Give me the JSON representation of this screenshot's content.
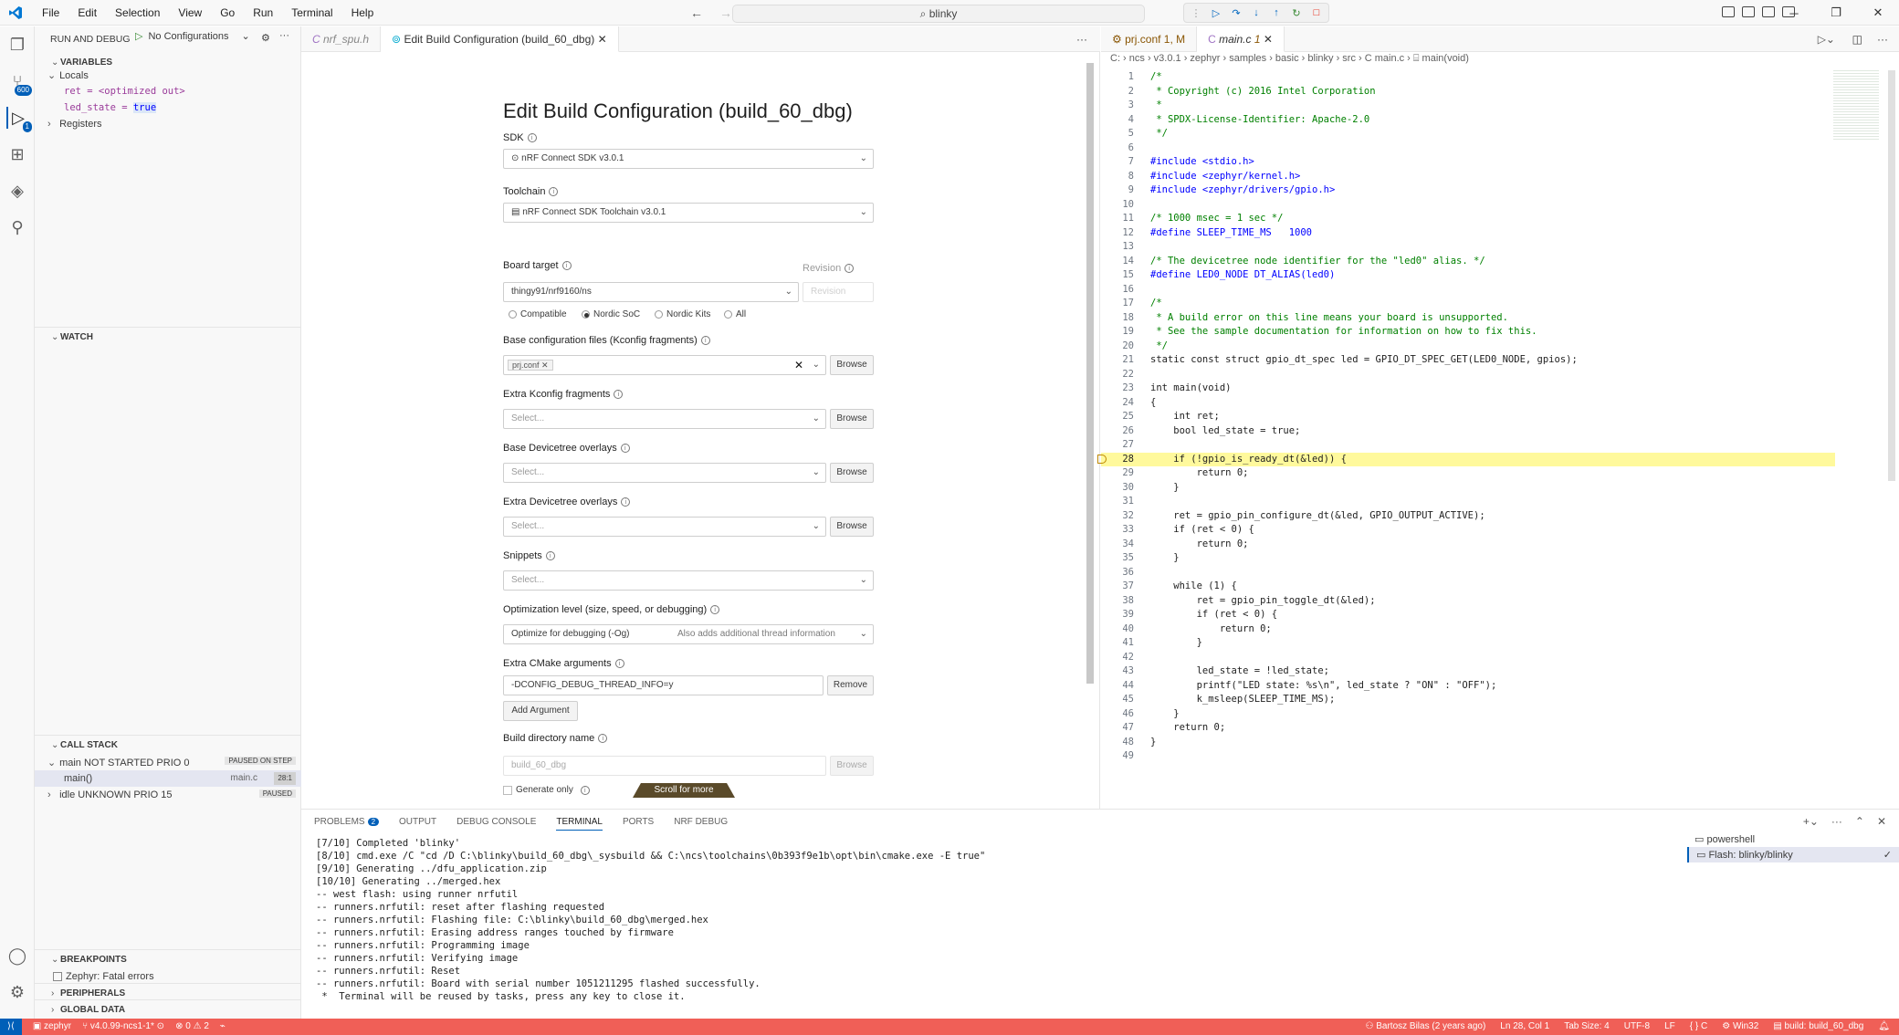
{
  "menu": [
    "File",
    "Edit",
    "Selection",
    "View",
    "Go",
    "Run",
    "Terminal",
    "Help"
  ],
  "search": {
    "text": "blinky"
  },
  "sidebar": {
    "title": "RUN AND DEBUG",
    "config": "No Configurations",
    "variables": {
      "title": "VARIABLES",
      "locals": "Locals",
      "ret": "ret = <optimized out>",
      "led_state_name": "led_state = ",
      "led_state_value": "true",
      "registers": "Registers"
    },
    "watch": "WATCH",
    "callstack": {
      "title": "CALL STACK",
      "thread1": "main NOT STARTED PRIO 0",
      "thread1_state": "PAUSED ON STEP",
      "frame": "main()",
      "frame_file": "main.c",
      "frame_pos": "28:1",
      "thread2": "idle UNKNOWN PRIO 15",
      "thread2_state": "PAUSED"
    },
    "breakpoints": "BREAKPOINTS",
    "bp_item": "Zephyr: Fatal errors",
    "peripherals": "PERIPHERALS",
    "global_data": "GLOBAL DATA"
  },
  "activity_badges": {
    "scm": "600",
    "debug": "1"
  },
  "left_tabs": [
    {
      "label": "nrf_spu.h"
    },
    {
      "label": "Edit Build Configuration (build_60_dbg)"
    }
  ],
  "form": {
    "title": "Edit Build Configuration (build_60_dbg)",
    "sdk_label": "SDK",
    "sdk_value": "nRF Connect SDK v3.0.1",
    "toolchain_label": "Toolchain",
    "toolchain_value": "nRF Connect SDK Toolchain v3.0.1",
    "board_label": "Board target",
    "board_value": "thingy91/nrf9160/ns",
    "revision_label": "Revision",
    "revision_placeholder": "Revision",
    "radios": [
      "Compatible",
      "Nordic SoC",
      "Nordic Kits",
      "All"
    ],
    "kconfig_label": "Base configuration files (Kconfig fragments)",
    "kconfig_chip": "prj.conf",
    "browse": "Browse",
    "extra_kconfig_label": "Extra Kconfig fragments",
    "select_placeholder": "Select...",
    "base_dt_label": "Base Devicetree overlays",
    "extra_dt_label": "Extra Devicetree overlays",
    "snippets_label": "Snippets",
    "opt_label": "Optimization level (size, speed, or debugging)",
    "opt_value": "Optimize for debugging (-Og)",
    "opt_hint": "Also adds additional thread information",
    "cmake_label": "Extra CMake arguments",
    "cmake_value": "-DCONFIG_DEBUG_THREAD_INFO=y",
    "remove": "Remove",
    "add_argument": "Add Argument",
    "builddir_label": "Build directory name",
    "builddir_placeholder": "build_60_dbg",
    "generate_only": "Generate only",
    "scroll_more": "Scroll for more"
  },
  "right_tabs": [
    {
      "label": "prj.conf",
      "suffix": "1, M"
    },
    {
      "label": "main.c",
      "suffix": "1"
    }
  ],
  "breadcrumb": "C: › ncs › v3.0.1 › zephyr › samples › basic › blinky › src › C  main.c › ⌸ main(void)",
  "code": [
    {
      "n": "1",
      "t": "/*",
      "c": "cm"
    },
    {
      "n": "2",
      "t": " * Copyright (c) 2016 Intel Corporation",
      "c": "cm"
    },
    {
      "n": "3",
      "t": " *",
      "c": "cm"
    },
    {
      "n": "4",
      "t": " * SPDX-License-Identifier: Apache-2.0",
      "c": "cm"
    },
    {
      "n": "5",
      "t": " */",
      "c": "cm"
    },
    {
      "n": "6",
      "t": "",
      "c": ""
    },
    {
      "n": "7",
      "t": "#include <stdio.h>",
      "c": "pp"
    },
    {
      "n": "8",
      "t": "#include <zephyr/kernel.h>",
      "c": "pp"
    },
    {
      "n": "9",
      "t": "#include <zephyr/drivers/gpio.h>",
      "c": "pp"
    },
    {
      "n": "10",
      "t": "",
      "c": ""
    },
    {
      "n": "11",
      "t": "/* 1000 msec = 1 sec */",
      "c": "cm"
    },
    {
      "n": "12",
      "t": "#define SLEEP_TIME_MS   1000",
      "c": "pp"
    },
    {
      "n": "13",
      "t": "",
      "c": ""
    },
    {
      "n": "14",
      "t": "/* The devicetree node identifier for the \"led0\" alias. */",
      "c": "cm"
    },
    {
      "n": "15",
      "t": "#define LED0_NODE DT_ALIAS(led0)",
      "c": "pp"
    },
    {
      "n": "16",
      "t": "",
      "c": ""
    },
    {
      "n": "17",
      "t": "/*",
      "c": "cm"
    },
    {
      "n": "18",
      "t": " * A build error on this line means your board is unsupported.",
      "c": "cm"
    },
    {
      "n": "19",
      "t": " * See the sample documentation for information on how to fix this.",
      "c": "cm"
    },
    {
      "n": "20",
      "t": " */",
      "c": "cm"
    },
    {
      "n": "21",
      "t": "static const struct gpio_dt_spec led = GPIO_DT_SPEC_GET(LED0_NODE, gpios);",
      "c": ""
    },
    {
      "n": "22",
      "t": "",
      "c": ""
    },
    {
      "n": "23",
      "t": "int main(void)",
      "c": ""
    },
    {
      "n": "24",
      "t": "{",
      "c": ""
    },
    {
      "n": "25",
      "t": "    int ret;",
      "c": ""
    },
    {
      "n": "26",
      "t": "    bool led_state = true;",
      "c": ""
    },
    {
      "n": "27",
      "t": "",
      "c": ""
    },
    {
      "n": "28",
      "t": "    if (!gpio_is_ready_dt(&led)) {",
      "c": ""
    },
    {
      "n": "29",
      "t": "        return 0;",
      "c": ""
    },
    {
      "n": "30",
      "t": "    }",
      "c": ""
    },
    {
      "n": "31",
      "t": "",
      "c": ""
    },
    {
      "n": "32",
      "t": "    ret = gpio_pin_configure_dt(&led, GPIO_OUTPUT_ACTIVE);",
      "c": ""
    },
    {
      "n": "33",
      "t": "    if (ret < 0) {",
      "c": ""
    },
    {
      "n": "34",
      "t": "        return 0;",
      "c": ""
    },
    {
      "n": "35",
      "t": "    }",
      "c": ""
    },
    {
      "n": "36",
      "t": "",
      "c": ""
    },
    {
      "n": "37",
      "t": "    while (1) {",
      "c": ""
    },
    {
      "n": "38",
      "t": "        ret = gpio_pin_toggle_dt(&led);",
      "c": ""
    },
    {
      "n": "39",
      "t": "        if (ret < 0) {",
      "c": ""
    },
    {
      "n": "40",
      "t": "            return 0;",
      "c": ""
    },
    {
      "n": "41",
      "t": "        }",
      "c": ""
    },
    {
      "n": "42",
      "t": "",
      "c": ""
    },
    {
      "n": "43",
      "t": "        led_state = !led_state;",
      "c": ""
    },
    {
      "n": "44",
      "t": "        printf(\"LED state: %s\\n\", led_state ? \"ON\" : \"OFF\");",
      "c": ""
    },
    {
      "n": "45",
      "t": "        k_msleep(SLEEP_TIME_MS);",
      "c": ""
    },
    {
      "n": "46",
      "t": "    }",
      "c": ""
    },
    {
      "n": "47",
      "t": "    return 0;",
      "c": ""
    },
    {
      "n": "48",
      "t": "}",
      "c": ""
    },
    {
      "n": "49",
      "t": "",
      "c": ""
    }
  ],
  "current_line": "28",
  "panel": {
    "tabs": [
      "PROBLEMS",
      "OUTPUT",
      "DEBUG CONSOLE",
      "TERMINAL",
      "PORTS",
      "NRF DEBUG"
    ],
    "problems_count": "2",
    "terminal": [
      "[7/10] Completed 'blinky'",
      "[8/10] cmd.exe /C \"cd /D C:\\blinky\\build_60_dbg\\_sysbuild && C:\\ncs\\toolchains\\0b393f9e1b\\opt\\bin\\cmake.exe -E true\"",
      "[9/10] Generating ../dfu_application.zip",
      "[10/10] Generating ../merged.hex",
      "-- west flash: using runner nrfutil",
      "-- runners.nrfutil: reset after flashing requested",
      "-- runners.nrfutil: Flashing file: C:\\blinky\\build_60_dbg\\merged.hex",
      "-- runners.nrfutil: Erasing address ranges touched by firmware",
      "-- runners.nrfutil: Programming image",
      "-- runners.nrfutil: Verifying image",
      "-- runners.nrfutil: Reset",
      "-- runners.nrfutil: Board with serial number 1051211295 flashed successfully.",
      " *  Terminal will be reused by tasks, press any key to close it."
    ],
    "terminals": [
      "powershell",
      "Flash: blinky/blinky"
    ]
  },
  "status": {
    "remote": "zephyr",
    "branch": "v4.0.99-ncs1-1*",
    "errors": "0",
    "warnings": "2",
    "blame": "Bartosz Bilas (2 years ago)",
    "position": "Ln 28, Col 1",
    "tabsize": "Tab Size: 4",
    "encoding": "UTF-8",
    "eol": "LF",
    "lang": "{ } C",
    "platform": "Win32",
    "build": "build: build_60_dbg"
  }
}
